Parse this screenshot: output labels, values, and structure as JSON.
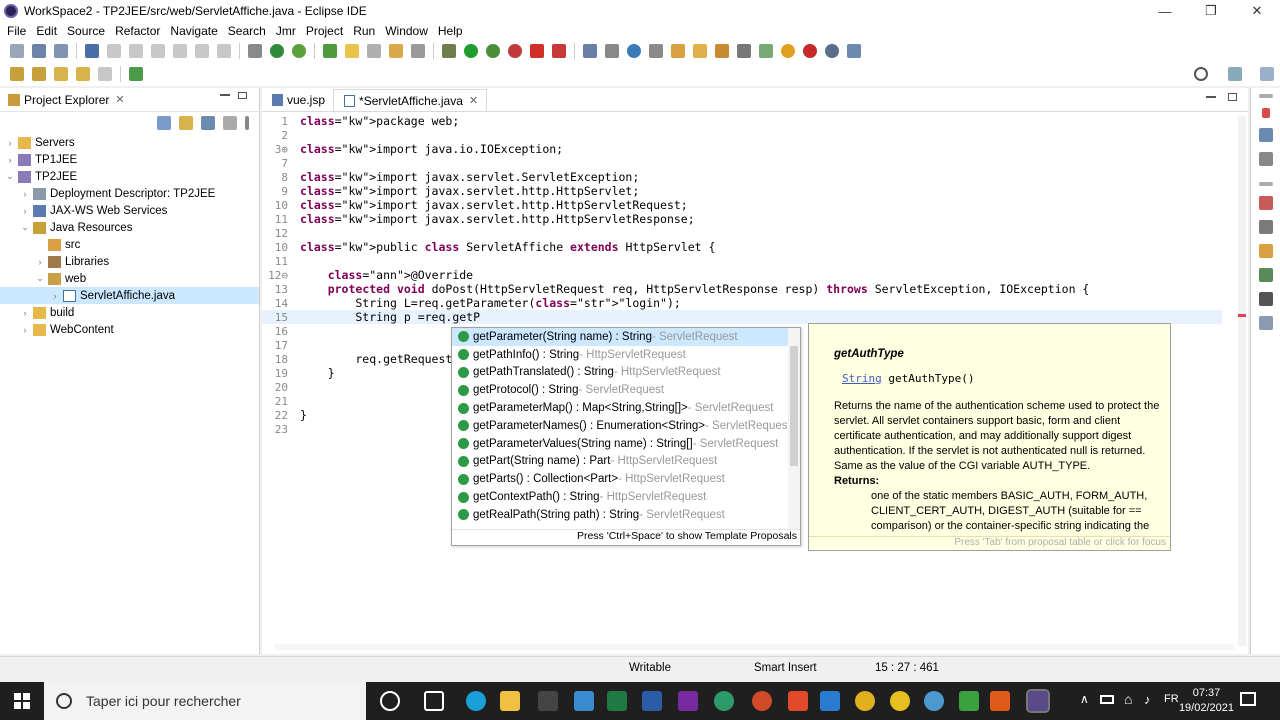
{
  "window": {
    "title": "WorkSpace2 - TP2JEE/src/web/ServletAffiche.java - Eclipse IDE",
    "minimize": "—",
    "restore": "❐",
    "close": "✕"
  },
  "menu": [
    "File",
    "Edit",
    "Source",
    "Refactor",
    "Navigate",
    "Search",
    "Jmr",
    "Project",
    "Run",
    "Window",
    "Help"
  ],
  "project_explorer": {
    "title": "Project Explorer",
    "close": "✕",
    "tree": [
      {
        "label": "Servers",
        "icon": "folder-icon",
        "indent": 0,
        "expanded": false
      },
      {
        "label": "TP1JEE",
        "icon": "project-icon",
        "indent": 0,
        "expanded": false
      },
      {
        "label": "TP2JEE",
        "icon": "project-icon",
        "indent": 0,
        "expanded": true
      },
      {
        "label": "Deployment Descriptor: TP2JEE",
        "icon": "descriptor-icon",
        "indent": 1,
        "expanded": false
      },
      {
        "label": "JAX-WS Web Services",
        "icon": "webservice-icon",
        "indent": 1,
        "expanded": false
      },
      {
        "label": "Java Resources",
        "icon": "java-resources-icon",
        "indent": 1,
        "expanded": true
      },
      {
        "label": "src",
        "icon": "package-folder-icon",
        "indent": 2,
        "expanded": null
      },
      {
        "label": "Libraries",
        "icon": "library-icon",
        "indent": 2,
        "expanded": false
      },
      {
        "label": "web",
        "icon": "package-icon",
        "indent": 2,
        "expanded": true
      },
      {
        "label": "ServletAffiche.java",
        "icon": "java-file-icon",
        "indent": 3,
        "expanded": false,
        "selected": true
      },
      {
        "label": "build",
        "icon": "folder-icon",
        "indent": 1,
        "expanded": false
      },
      {
        "label": "WebContent",
        "icon": "folder-icon",
        "indent": 1,
        "expanded": false
      }
    ]
  },
  "editor": {
    "tabs": [
      {
        "label": "vue.jsp",
        "active": false
      },
      {
        "label": "*ServletAffiche.java",
        "active": true
      }
    ],
    "lines": [
      {
        "n": "1",
        "text": "package web;"
      },
      {
        "n": "2",
        "text": ""
      },
      {
        "n": "3⊕",
        "text": "import java.io.IOException;"
      },
      {
        "n": "7",
        "text": ""
      },
      {
        "n": "8",
        "text": "import javax.servlet.ServletException;"
      },
      {
        "n": "9",
        "text": "import javax.servlet.http.HttpServlet;"
      },
      {
        "n": "10",
        "text": "import javax.servlet.http.HttpServletRequest;"
      },
      {
        "n": "11",
        "text": "import javax.servlet.http.HttpServletResponse;"
      },
      {
        "n": "12",
        "text": ""
      },
      {
        "n": "10",
        "text": "public class ServletAffiche extends HttpServlet {"
      },
      {
        "n": "11",
        "text": ""
      },
      {
        "n": "12⊖",
        "text": "    @Override"
      },
      {
        "n": "13",
        "text": "    protected void doPost(HttpServletRequest req, HttpServletResponse resp) throws ServletException, IOException {"
      },
      {
        "n": "14",
        "text": "        String L=req.getParameter(\"login\");"
      },
      {
        "n": "15",
        "text": "        String p =req.getP"
      },
      {
        "n": "16",
        "text": ""
      },
      {
        "n": "17",
        "text": ""
      },
      {
        "n": "18",
        "text": "        req.getRequestD"
      },
      {
        "n": "19",
        "text": "    }"
      },
      {
        "n": "20",
        "text": ""
      },
      {
        "n": "21",
        "text": ""
      },
      {
        "n": "22",
        "text": "}"
      },
      {
        "n": "23",
        "text": ""
      }
    ]
  },
  "completion": {
    "items": [
      {
        "sig": "getParameter(String name) : String",
        "type": " - ServletRequest",
        "selected": true
      },
      {
        "sig": "getPathInfo() : String",
        "type": " - HttpServletRequest"
      },
      {
        "sig": "getPathTranslated() : String",
        "type": " - HttpServletRequest"
      },
      {
        "sig": "getProtocol() : String",
        "type": " - ServletRequest"
      },
      {
        "sig": "getParameterMap() : Map<String,String[]>",
        "type": " - ServletRequest"
      },
      {
        "sig": "getParameterNames() : Enumeration<String>",
        "type": " - ServletRequest"
      },
      {
        "sig": "getParameterValues(String name) : String[]",
        "type": " - ServletRequest"
      },
      {
        "sig": "getPart(String name) : Part",
        "type": " - HttpServletRequest"
      },
      {
        "sig": "getParts() : Collection<Part>",
        "type": " - HttpServletRequest"
      },
      {
        "sig": "getContextPath() : String",
        "type": " - HttpServletRequest"
      },
      {
        "sig": "getRealPath(String path) : String",
        "type": " - ServletRequest"
      }
    ],
    "footer": "Press 'Ctrl+Space' to show Template Proposals"
  },
  "javadoc": {
    "title": "getAuthType",
    "sig_type": "String",
    "sig_name": " getAuthType()",
    "body": "Returns the name of the authentication scheme used to protect the servlet. All servlet containers support basic, form and client certificate authentication, and may additionally support digest authentication. If the servlet is not authenticated null is returned. Same as the value of the CGI variable AUTH_TYPE.",
    "returns_label": "Returns:",
    "returns_body": "one of the static members BASIC_AUTH, FORM_AUTH, CLIENT_CERT_AUTH, DIGEST_AUTH (suitable for == comparison) or the container-specific string indicating the",
    "footer": "Press 'Tab' from proposal table or click for focus"
  },
  "status": {
    "writable": "Writable",
    "insert_mode": "Smart Insert",
    "position": "15 : 27 : 461"
  },
  "taskbar": {
    "search_placeholder": "Taper ici pour rechercher",
    "time": "07:37",
    "date": "19/02/2021"
  },
  "colors": {
    "keyword": "#7f0055",
    "string": "#2a00ff",
    "selection": "#cce8ff",
    "javadoc_bg": "#ffffe1",
    "taskbar": "#1f1f1f"
  }
}
